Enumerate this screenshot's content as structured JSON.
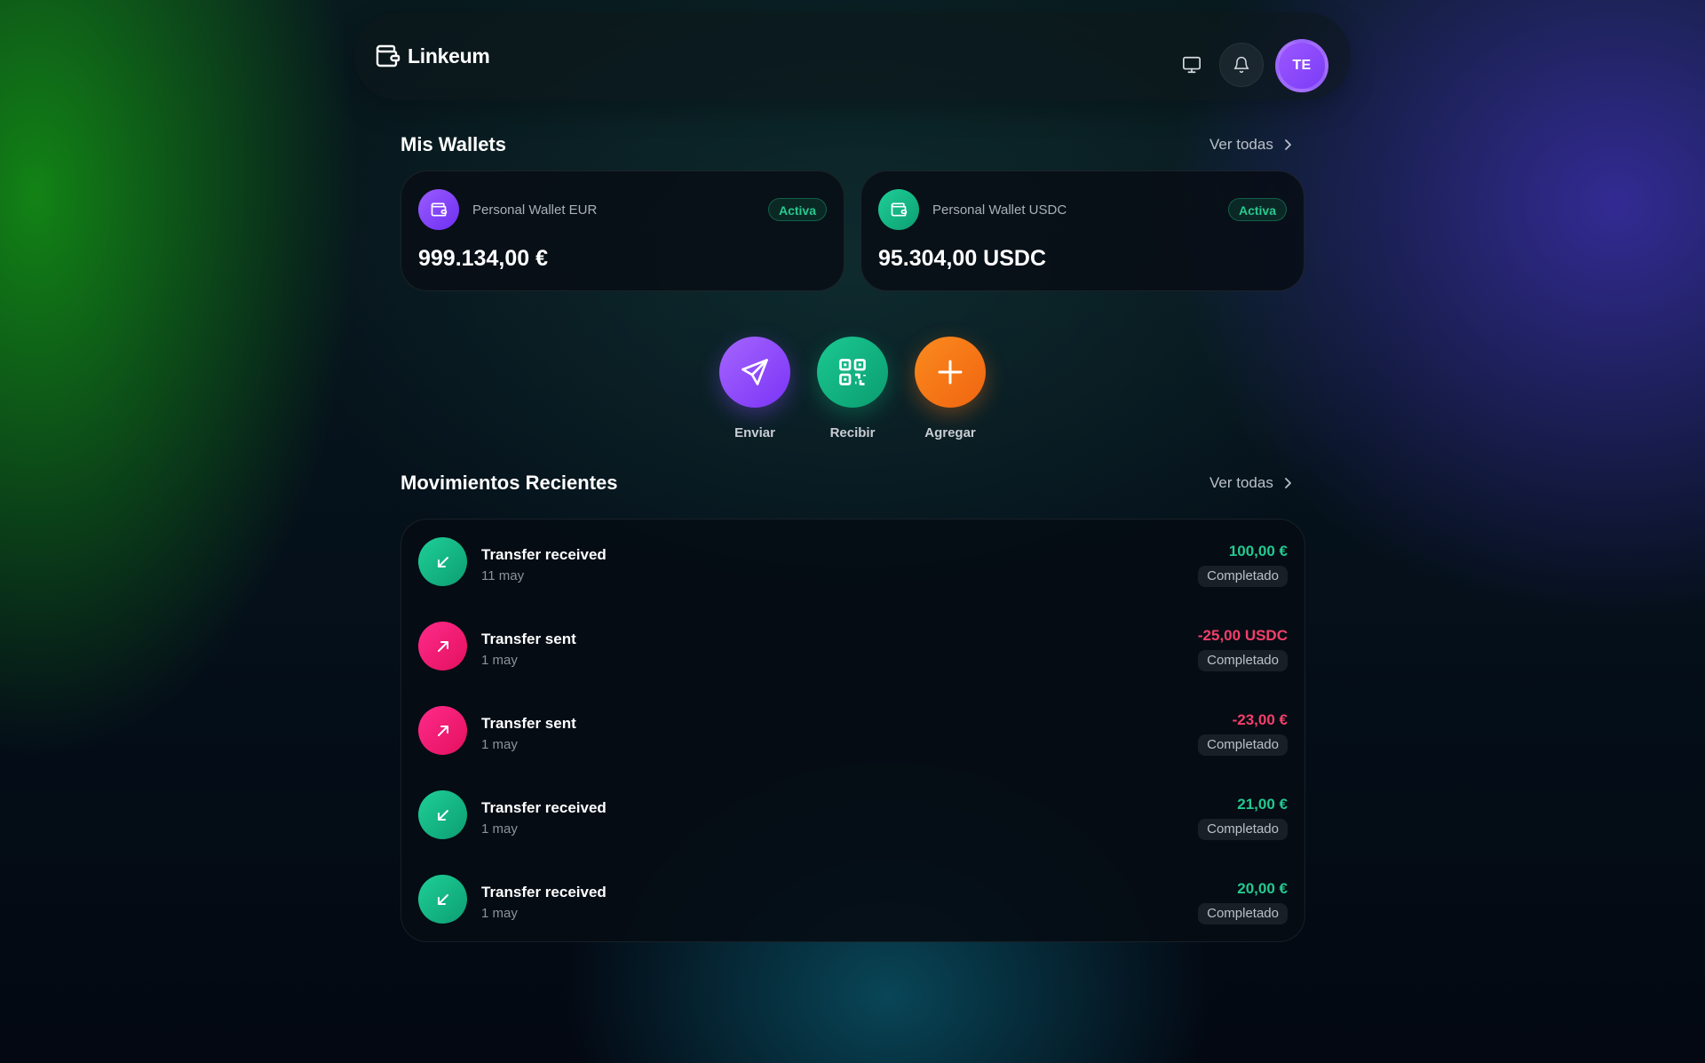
{
  "app": {
    "name": "Linkeum"
  },
  "header": {
    "avatar_initials": "TE",
    "icons": [
      "wallet-logo-icon",
      "monitor-icon",
      "bell-icon"
    ]
  },
  "wallets_section": {
    "title": "Mis Wallets",
    "see_all": "Ver todas",
    "wallets": [
      {
        "name": "Personal Wallet EUR",
        "status": "Activa",
        "balance": "999.134,00 €",
        "icon_color": "#7c3cf6"
      },
      {
        "name": "Personal Wallet USDC",
        "status": "Activa",
        "balance": "95.304,00 USDC",
        "icon_color": "#12b886"
      }
    ]
  },
  "actions": [
    {
      "label": "Enviar",
      "icon": "send-icon",
      "color": "#8b4dff"
    },
    {
      "label": "Recibir",
      "icon": "qr-code-icon",
      "color": "#10b981"
    },
    {
      "label": "Agregar",
      "icon": "plus-icon",
      "color": "#f97316"
    }
  ],
  "transactions_section": {
    "title": "Movimientos Recientes",
    "see_all": "Ver todas",
    "items": [
      {
        "title": "Transfer received",
        "date": "11 may",
        "amount": "100,00 €",
        "status": "Completado",
        "direction": "in"
      },
      {
        "title": "Transfer sent",
        "date": "1 may",
        "amount": "-25,00 USDC",
        "status": "Completado",
        "direction": "out"
      },
      {
        "title": "Transfer sent",
        "date": "1 may",
        "amount": "-23,00 €",
        "status": "Completado",
        "direction": "out"
      },
      {
        "title": "Transfer received",
        "date": "1 may",
        "amount": "21,00 €",
        "status": "Completado",
        "direction": "in"
      },
      {
        "title": "Transfer received",
        "date": "1 may",
        "amount": "20,00 €",
        "status": "Completado",
        "direction": "in"
      }
    ]
  },
  "colors": {
    "positive": "#22c990",
    "negative": "#f43f6b",
    "incoming_icon": "#12b886",
    "outgoing_icon": "#f0197a"
  }
}
